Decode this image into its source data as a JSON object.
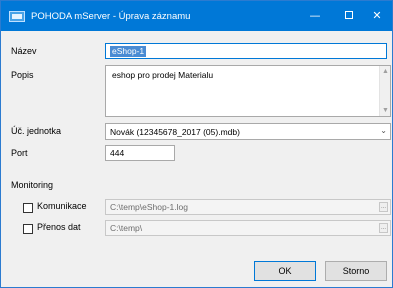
{
  "window": {
    "title": "POHODA mServer - Úprava záznamu",
    "minimize_glyph": "—",
    "close_glyph": "✕"
  },
  "form": {
    "name_label": "Název",
    "name_value": "eShop-1",
    "desc_label": "Popis",
    "desc_value": "eshop pro prodej Materialu",
    "unit_label": "Úč. jednotka",
    "unit_value": "Novák (12345678_2017 (05).mdb)",
    "port_label": "Port",
    "port_value": "444"
  },
  "monitoring": {
    "section_label": "Monitoring",
    "comm_label": "Komunikace",
    "comm_path": "C:\\temp\\eShop-1.log",
    "transfer_label": "Přenos dat",
    "transfer_path": "C:\\temp\\",
    "browse_glyph": "..."
  },
  "buttons": {
    "ok": "OK",
    "cancel": "Storno"
  }
}
